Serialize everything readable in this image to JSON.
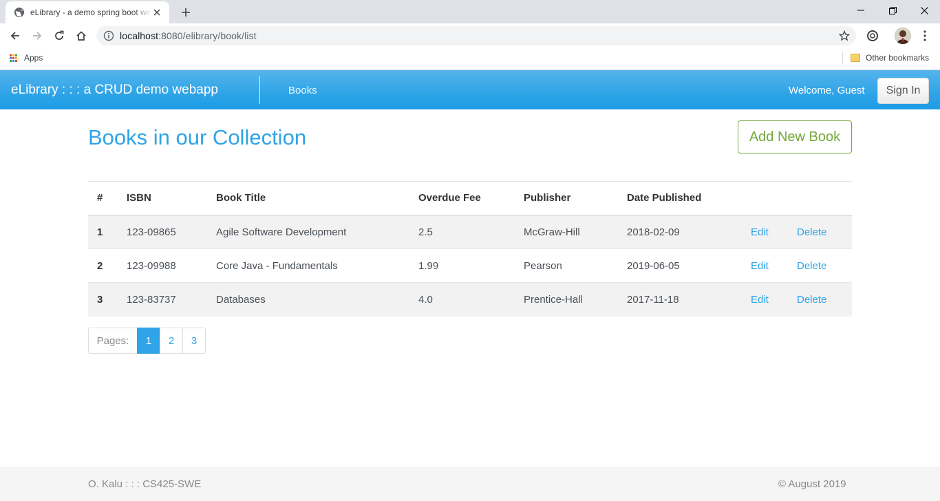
{
  "browser": {
    "tab_title": "eLibrary - a demo spring boot webapp",
    "url_host": "localhost",
    "url_rest": ":8080/elibrary/book/list",
    "bookmarks": {
      "apps_label": "Apps",
      "other_label": "Other bookmarks"
    }
  },
  "navbar": {
    "brand": "eLibrary : : : a CRUD demo webapp",
    "books_link": "Books",
    "welcome": "Welcome, Guest",
    "signin_label": "Sign In",
    "color": "#2fa4e7"
  },
  "main": {
    "title": "Books in our Collection",
    "add_button": "Add New Book",
    "table": {
      "headers": [
        "#",
        "ISBN",
        "Book Title",
        "Overdue Fee",
        "Publisher",
        "Date Published",
        "",
        ""
      ],
      "rows": [
        [
          "1",
          "123-09865",
          "Agile Software Development",
          "2.5",
          "McGraw-Hill",
          "2018-02-09",
          "Edit",
          "Delete"
        ],
        [
          "2",
          "123-09988",
          "Core Java - Fundamentals",
          "1.99",
          "Pearson",
          "2019-06-05",
          "Edit",
          "Delete"
        ],
        [
          "3",
          "123-83737",
          "Databases",
          "4.0",
          "Prentice-Hall",
          "2017-11-18",
          "Edit",
          "Delete"
        ]
      ]
    },
    "pagination": {
      "label": "Pages:",
      "pages": [
        "1",
        "2",
        "3"
      ],
      "active": "1"
    }
  },
  "footer": {
    "left": "O. Kalu : : : CS425-SWE",
    "right": "© August 2019"
  }
}
